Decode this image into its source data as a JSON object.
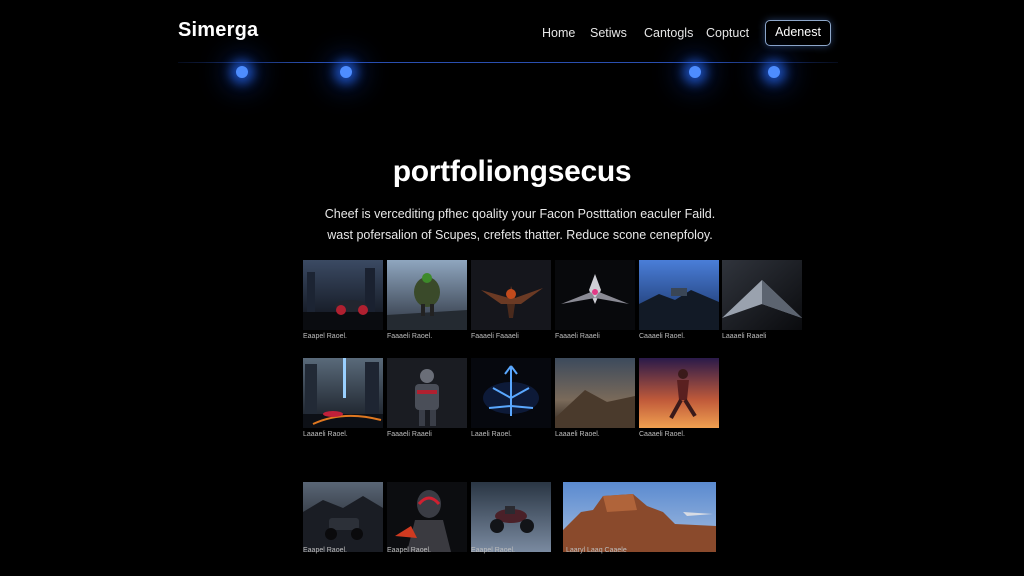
{
  "header": {
    "logo": "Simerga",
    "nav": [
      "Home",
      "Setiws",
      "Cantogls",
      "Coptuct"
    ],
    "button_label": "Adenest"
  },
  "hero": {
    "title": "portfoliongsecus",
    "description_line1": "Cheef is vercediting pfhec qoality your Facon Postttation eaculer Faild.",
    "description_line2": "wast pofersalion of Scupes, crefets thatter. Reduce scone cenepfoloy."
  },
  "gallery": {
    "row1": [
      {
        "caption": "Eaapel Raoel.",
        "icon": "motorcycle-city-image"
      },
      {
        "caption": "Faaaeli Raoel.",
        "icon": "armored-warrior-image"
      },
      {
        "caption": "Faaaeli Faaaeli",
        "icon": "dragon-creature-image"
      },
      {
        "caption": "Faaaeli Raaeli",
        "icon": "spaceship-image"
      },
      {
        "caption": "Caaaeli Raoel.",
        "icon": "landscape-blue-image"
      },
      {
        "caption": "Laaaeli Raaeli",
        "icon": "pyramid-image"
      }
    ],
    "row2": [
      {
        "caption": "Laaaeli Raoel.",
        "icon": "city-racer-image"
      },
      {
        "caption": "Faaaeli Raaeli",
        "icon": "cyber-knight-image"
      },
      {
        "caption": "Laaeli Raoel.",
        "icon": "neon-tree-image"
      },
      {
        "caption": "Laaaeli Raoel.",
        "icon": "desert-dune-image"
      },
      {
        "caption": "Caaaeli Raoel.",
        "icon": "runner-sunset-image"
      }
    ],
    "row3": [
      {
        "caption": "Eaapel Raoel.",
        "icon": "atv-vehicle-image"
      },
      {
        "caption": "Eaapel Raoel.",
        "icon": "red-helmet-image"
      },
      {
        "caption": "Eaapel Raoel.",
        "icon": "bike-snow-image"
      },
      {
        "caption": "Laaryl Laaq Caaele",
        "icon": "mesa-landscape-image"
      }
    ]
  }
}
